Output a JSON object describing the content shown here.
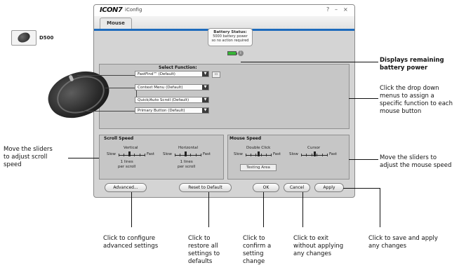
{
  "app": {
    "brand": "ICON7",
    "title": "iConfig",
    "window_controls": {
      "help": "?",
      "minimize": "–",
      "close": "×"
    },
    "tab": "Mouse"
  },
  "device": {
    "name": "D500"
  },
  "battery": {
    "title": "Battery Status:",
    "line1": "5000 battery power",
    "line2": "so no action required"
  },
  "select_function": {
    "title": "Select Function:",
    "dropdowns": [
      "FastFind™ (Default)",
      "Context Menu (Default)",
      "Quick/Auto Scroll (Default)",
      "Primary Button (Default)"
    ]
  },
  "scroll_speed": {
    "title": "Scroll Speed",
    "vertical": {
      "label": "Vertical",
      "slow": "Slow",
      "fast": "Fast",
      "value_text": "1 lines\nper scroll",
      "level": 0.4
    },
    "horizontal": {
      "label": "Horizontal",
      "slow": "Slow",
      "fast": "Fast",
      "value_text": "1 lines\nper scroll",
      "level": 0.4
    }
  },
  "mouse_speed": {
    "title": "Mouse Speed",
    "double_click": {
      "label": "Double Click",
      "slow": "Slow",
      "fast": "Fast",
      "level": 0.5
    },
    "cursor": {
      "label": "Cursor",
      "slow": "Slow",
      "fast": "Fast",
      "level": 0.5
    },
    "testing_area": "Testing Area"
  },
  "buttons": {
    "advanced": "Advanced...",
    "reset": "Reset to Default",
    "ok": "OK",
    "cancel": "Cancel",
    "apply": "Apply"
  },
  "callouts": {
    "battery": "Displays remaining\nbattery power",
    "dropdowns": "Click the drop down\nmenus to assign a\nspecific function to each\nmouse button",
    "scroll": "Move the sliders\nto adjust scroll\nspeed",
    "mouse_speed": "Move the sliders to\nadjust the mouse speed",
    "advanced": "Click to configure\nadvanced settings",
    "reset": "Click to\nrestore all\nsettings to\ndefaults",
    "ok": "Click to\nconfirm a\nsetting\nchange",
    "cancel": "Click to exit\nwithout applying\nany changes",
    "apply": "Click to save and apply\nany changes"
  }
}
